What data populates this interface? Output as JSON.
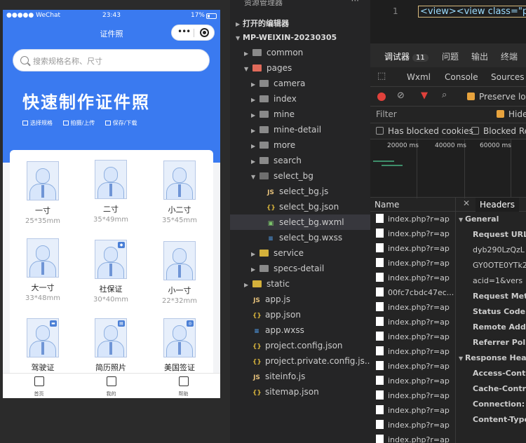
{
  "simulator": {
    "status": {
      "carrier": "●●●●● WeChat",
      "time": "23:43",
      "battery": "17%"
    },
    "nav_title": "证件照",
    "capsule": {
      "more": "•••"
    },
    "search_placeholder": "搜索规格名称、尺寸",
    "hero": {
      "title": "快速制作证件照",
      "tags": [
        "选择规格",
        "拍摄/上传",
        "保存/下载"
      ]
    },
    "specs": [
      {
        "name": "一寸",
        "size": "25*35mm"
      },
      {
        "name": "二寸",
        "size": "35*49mm"
      },
      {
        "name": "小二寸",
        "size": "35*45mm"
      },
      {
        "name": "大一寸",
        "size": "33*48mm"
      },
      {
        "name": "社保证",
        "size": "30*40mm"
      },
      {
        "name": "小一寸",
        "size": "22*32mm"
      },
      {
        "name": "驾驶证",
        "size": ""
      },
      {
        "name": "简历照片",
        "size": ""
      },
      {
        "name": "美国签证",
        "size": ""
      }
    ],
    "tabbar": [
      "首页",
      "我的",
      "帮助"
    ]
  },
  "explorer": {
    "title": "资源管理器",
    "more": "···",
    "open_editors": "打开的编辑器",
    "project": "MP-WEIXIN-20230305",
    "tree": [
      {
        "label": "common",
        "type": "folder"
      },
      {
        "label": "pages",
        "type": "folder-open"
      },
      {
        "label": "camera",
        "type": "folder"
      },
      {
        "label": "index",
        "type": "folder"
      },
      {
        "label": "mine",
        "type": "folder"
      },
      {
        "label": "mine-detail",
        "type": "folder"
      },
      {
        "label": "more",
        "type": "folder"
      },
      {
        "label": "search",
        "type": "folder"
      },
      {
        "label": "select_bg",
        "type": "folder-open"
      },
      {
        "label": "select_bg.js",
        "type": "js"
      },
      {
        "label": "select_bg.json",
        "type": "json"
      },
      {
        "label": "select_bg.wxml",
        "type": "wxml"
      },
      {
        "label": "select_bg.wxss",
        "type": "wxss"
      },
      {
        "label": "service",
        "type": "folder"
      },
      {
        "label": "specs-detail",
        "type": "folder"
      },
      {
        "label": "static",
        "type": "folder"
      },
      {
        "label": "app.js",
        "type": "js"
      },
      {
        "label": "app.json",
        "type": "json"
      },
      {
        "label": "app.wxss",
        "type": "wxss"
      },
      {
        "label": "project.config.json",
        "type": "json"
      },
      {
        "label": "project.private.config.js...",
        "type": "json"
      },
      {
        "label": "siteinfo.js",
        "type": "js"
      },
      {
        "label": "sitemap.json",
        "type": "json"
      }
    ]
  },
  "editor": {
    "line": "1",
    "code": "<view><view class=\"p"
  },
  "devtools": {
    "tabs": [
      "调试器",
      "问题",
      "输出",
      "终端"
    ],
    "debugger_count": "11",
    "subtabs": [
      "Wxml",
      "Console",
      "Sources"
    ],
    "preserve_log": "Preserve log",
    "filter_placeholder": "Filter",
    "hide": "Hide",
    "has_blocked_cookies": "Has blocked cookies",
    "blocked_requests": "Blocked Re",
    "timeline_labels": [
      "20000 ms",
      "40000 ms",
      "60000 ms"
    ],
    "list_header": "Name",
    "requests": [
      "index.php?r=ap",
      "index.php?r=ap",
      "index.php?r=ap",
      "index.php?r=ap",
      "index.php?r=ap",
      "00fc7cbdc47ec...",
      "index.php?r=ap",
      "index.php?r=ap",
      "index.php?r=ap",
      "index.php?r=ap",
      "index.php?r=ap",
      "index.php?r=ap",
      "index.php?r=ap",
      "index.php?r=ap",
      "index.php?r=ap",
      "index.php?r=ap"
    ],
    "details_tab": "Headers",
    "details": [
      "General",
      "Request URL:",
      "dyb290LzQzL",
      "GY0OTE0YTk2",
      "acid=1&vers",
      "Request Meth",
      "Status Code:",
      "Remote Addr",
      "Referrer Poli",
      "Response Hea",
      "Access-Contr",
      "Cache-Contro",
      "Connection:",
      "Content-Type"
    ]
  }
}
